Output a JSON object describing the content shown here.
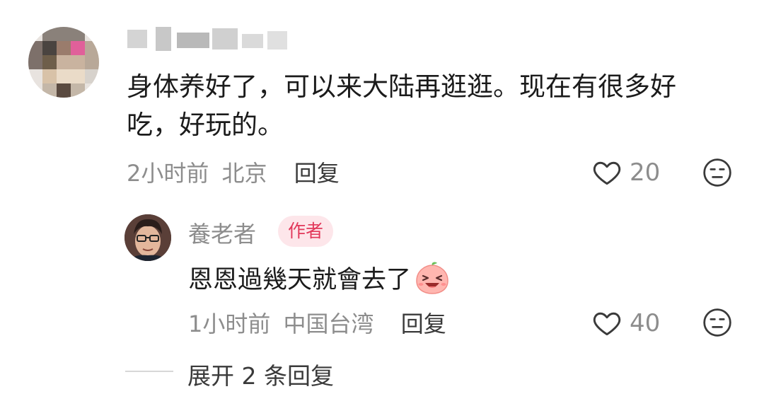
{
  "comment": {
    "text": "身体养好了，可以来大陆再逛逛。现在有很多好吃，好玩的。",
    "time": "2小时前",
    "location": "北京",
    "reply_label": "回复",
    "likes": "20",
    "avatar_icon": "pixelated-avatar-icon",
    "username_blurred": true
  },
  "reply": {
    "username": "養老者",
    "badge": "作者",
    "text": "恩恩過幾天就會去了",
    "emoji_icon": "laughing-peach-emoji-icon",
    "time": "1小时前",
    "location": "中国台湾",
    "reply_label": "回复",
    "likes": "40"
  },
  "expand_label": "展开 2 条回复",
  "colors": {
    "badge_bg": "#fde6ea",
    "badge_text": "#e2385a",
    "meta": "#8d8d8d"
  }
}
